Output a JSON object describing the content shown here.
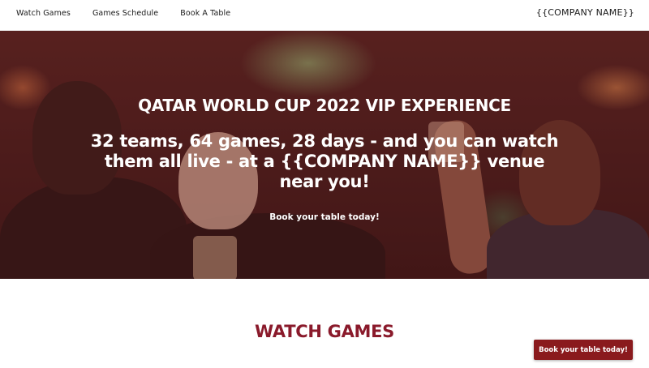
{
  "nav": {
    "items": [
      {
        "label": "Watch Games"
      },
      {
        "label": "Games Schedule"
      },
      {
        "label": "Book A Table"
      }
    ],
    "brand": "{{COMPANY NAME}}"
  },
  "hero": {
    "title": "QATAR WORLD CUP 2022 VIP EXPERIENCE",
    "subtitle": "32 teams, 64 games, 28 days - and you can watch them all live - at a {{COMPANY NAME}} venue near you!",
    "cta_text": "Book your table today!"
  },
  "sections": {
    "watch_games_heading": "WATCH GAMES"
  },
  "floating_button": {
    "label": "Book your table today!"
  },
  "colors": {
    "brand_maroon": "#8a1a1d",
    "heading_maroon": "#8a1a2b"
  }
}
